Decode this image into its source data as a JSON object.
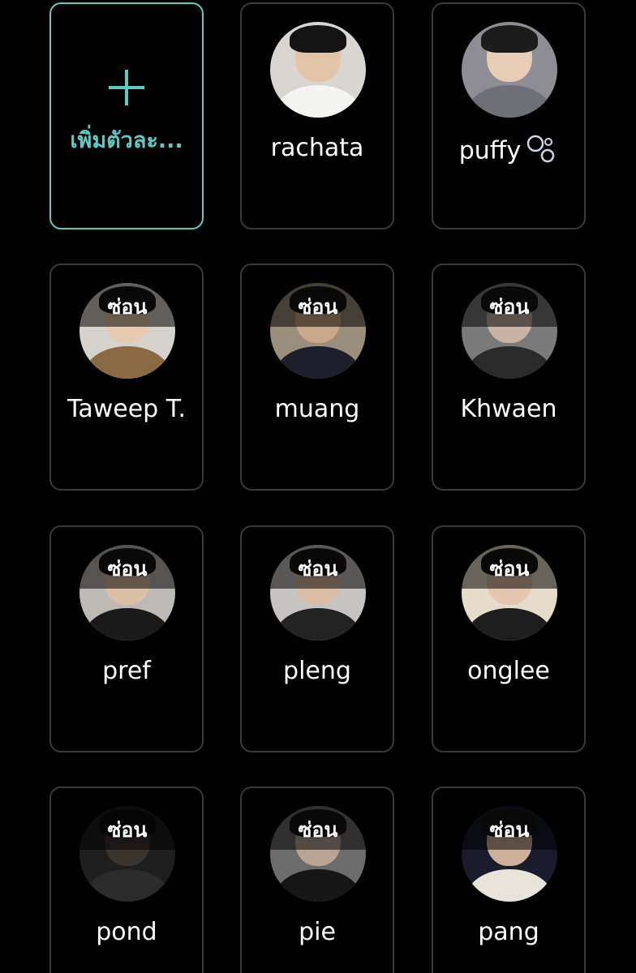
{
  "add_card": {
    "label": "เพิ่มตัวละ...",
    "icon": "plus-icon",
    "accent": "#5fc9bf"
  },
  "hide_label": "ซ่อน",
  "characters": [
    {
      "name": "rachata",
      "hidden": false,
      "emoji_icon": ""
    },
    {
      "name": "puffy",
      "hidden": false,
      "emoji_icon": "bubbles-icon"
    },
    {
      "name": "Taweep T.",
      "hidden": true,
      "emoji_icon": ""
    },
    {
      "name": "muang",
      "hidden": true,
      "emoji_icon": ""
    },
    {
      "name": "Khwaen",
      "hidden": true,
      "emoji_icon": ""
    },
    {
      "name": "pref",
      "hidden": true,
      "emoji_icon": ""
    },
    {
      "name": "pleng",
      "hidden": true,
      "emoji_icon": ""
    },
    {
      "name": "onglee",
      "hidden": true,
      "emoji_icon": ""
    },
    {
      "name": "pond",
      "hidden": true,
      "emoji_icon": ""
    },
    {
      "name": "pie",
      "hidden": true,
      "emoji_icon": ""
    },
    {
      "name": "pang",
      "hidden": true,
      "emoji_icon": ""
    }
  ],
  "colors": {
    "background": "#000000",
    "card_border": "#3a3a3c",
    "text": "#ffffff"
  }
}
